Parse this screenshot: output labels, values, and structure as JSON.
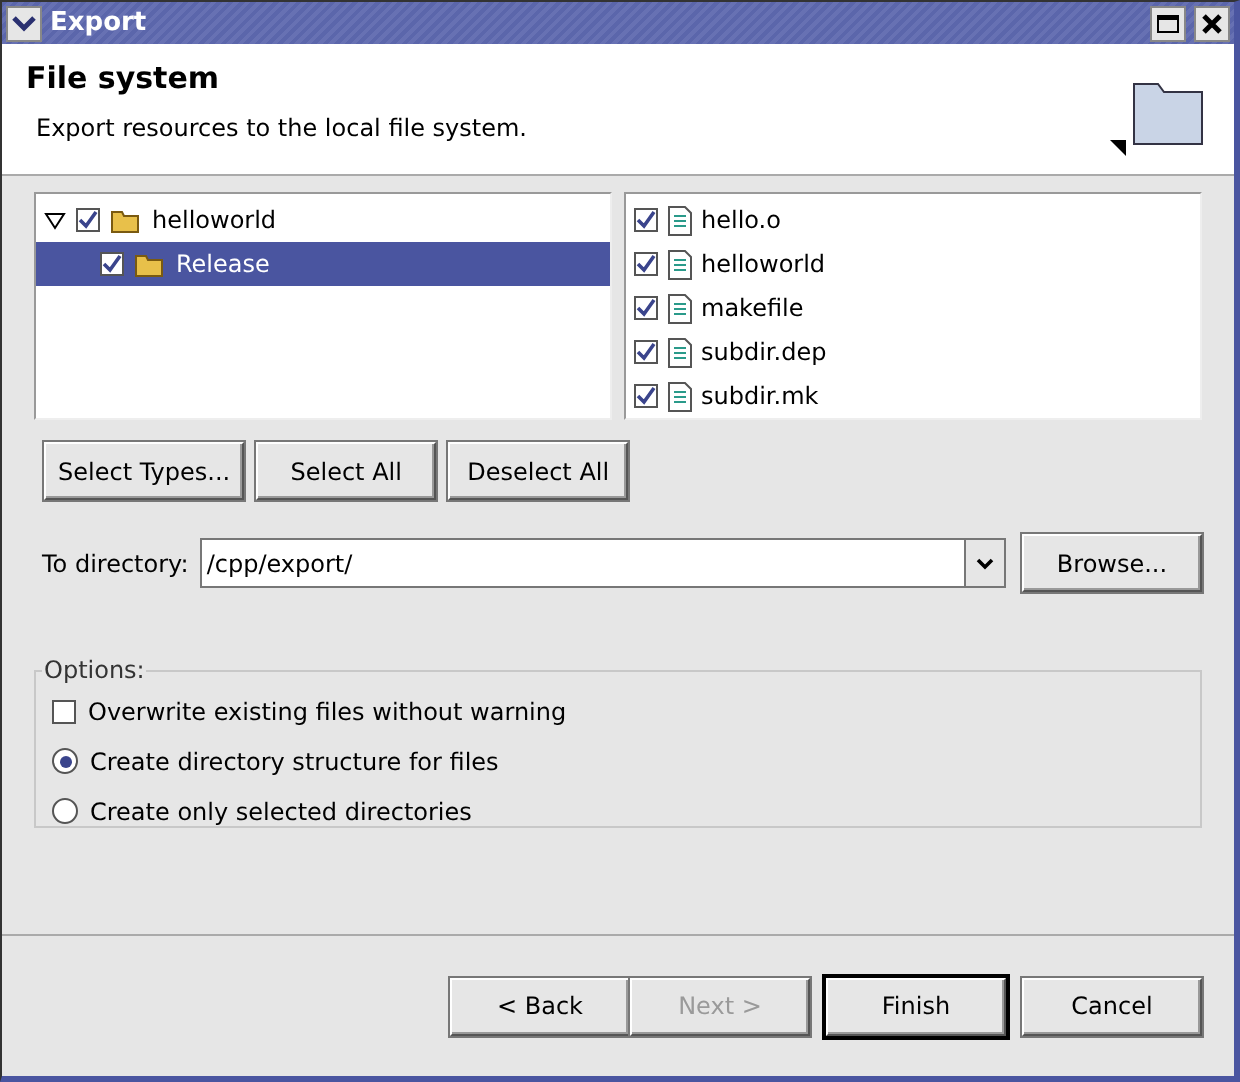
{
  "window": {
    "title": "Export"
  },
  "header": {
    "title": "File system",
    "description": "Export resources to the local file system."
  },
  "tree": [
    {
      "label": "helloworld",
      "checked": true,
      "expanded": true,
      "selected": false,
      "children": [
        {
          "label": "Release",
          "checked": true,
          "selected": true
        }
      ]
    }
  ],
  "files": [
    {
      "label": "hello.o",
      "checked": true
    },
    {
      "label": "helloworld",
      "checked": true
    },
    {
      "label": "makefile",
      "checked": true
    },
    {
      "label": "subdir.dep",
      "checked": true
    },
    {
      "label": "subdir.mk",
      "checked": true
    }
  ],
  "selection_buttons": [
    "Select Types...",
    "Select All",
    "Deselect All"
  ],
  "destination": {
    "label": "To directory:",
    "value": "/cpp/export/",
    "browse": "Browse..."
  },
  "options": {
    "title": "Options:",
    "items": [
      {
        "kind": "checkbox",
        "label": "Overwrite existing files without warning",
        "checked": false
      },
      {
        "kind": "radio",
        "label": "Create directory structure for files",
        "checked": true
      },
      {
        "kind": "radio",
        "label": "Create only selected directories",
        "checked": false
      }
    ]
  },
  "footer_buttons": [
    {
      "label": "< Back",
      "disabled": false,
      "default": false
    },
    {
      "label": "Next >",
      "disabled": true,
      "default": false
    },
    {
      "label": "Finish",
      "disabled": false,
      "default": true
    },
    {
      "label": "Cancel",
      "disabled": false,
      "default": false
    }
  ]
}
